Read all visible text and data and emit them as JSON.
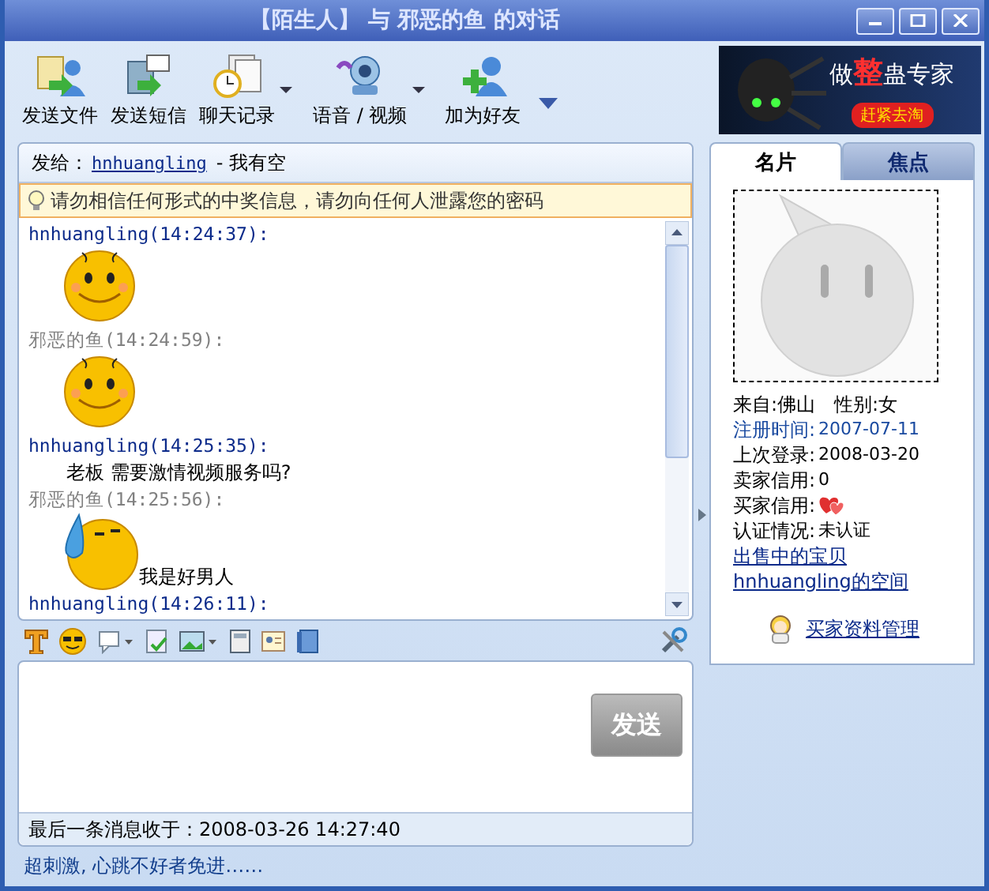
{
  "window": {
    "title": "【陌生人】 与 邪恶的鱼 的对话"
  },
  "toolbar": [
    {
      "label": "发送文件",
      "kind": "file",
      "has_menu": false
    },
    {
      "label": "发送短信",
      "kind": "sms",
      "has_menu": false
    },
    {
      "label": "聊天记录",
      "kind": "history",
      "has_menu": true
    },
    {
      "label": "语音 / 视频",
      "kind": "camera",
      "has_menu": true
    },
    {
      "label": "加为好友",
      "kind": "add-friend",
      "has_menu": false
    }
  ],
  "ad": {
    "headline_pre": "做",
    "headline_mark": "整",
    "headline_post": "蛊专家",
    "button": "赶紧去淘"
  },
  "chat": {
    "to_label": "发给：",
    "to_user": "hnhuangling",
    "to_status": "- 我有空",
    "warning": "请勿相信任何形式的中奖信息，请勿向任何人泄露您的密码",
    "messages": [
      {
        "header": "hnhuangling(14:24:37):",
        "own": false,
        "body": [
          {
            "kind": "smiley"
          }
        ]
      },
      {
        "header": "邪恶的鱼(14:24:59):",
        "own": true,
        "body": [
          {
            "kind": "smiley"
          }
        ]
      },
      {
        "header": "hnhuangling(14:25:35):",
        "own": false,
        "body": [
          {
            "kind": "text",
            "text": "老板 需要激情视频服务吗?"
          }
        ]
      },
      {
        "header": "邪恶的鱼(14:25:56):",
        "own": true,
        "body": [
          {
            "kind": "sweat",
            "text": "我是好男人"
          }
        ]
      },
      {
        "header": "hnhuangling(14:26:11):",
        "own": false
      }
    ]
  },
  "send_button": "发送",
  "last_message": "最后一条消息收于：2008-03-26 14:27:40",
  "footer": "超刺激, 心跳不好者免进……",
  "tabs": [
    {
      "label": "名片",
      "selected": true
    },
    {
      "label": "焦点",
      "selected": false
    }
  ],
  "profile": {
    "rows": [
      {
        "kind": "pair",
        "items": [
          "来自:佛山",
          "性别:女"
        ]
      },
      {
        "kind": "field",
        "label": "注册时间:",
        "value": "2007-07-11",
        "highlight": true
      },
      {
        "kind": "field",
        "label": "上次登录:",
        "value": "2008-03-20",
        "highlight": false
      },
      {
        "kind": "field",
        "label": "卖家信用:",
        "value": "0",
        "highlight": false
      },
      {
        "kind": "hearts",
        "label": "买家信用:"
      },
      {
        "kind": "field",
        "label": "认证情况:",
        "value": "未认证",
        "highlight": false
      },
      {
        "kind": "link",
        "text": "出售中的宝贝"
      },
      {
        "kind": "link",
        "text": "hnhuangling的空间"
      }
    ],
    "manage_link": "买家资料管理"
  }
}
